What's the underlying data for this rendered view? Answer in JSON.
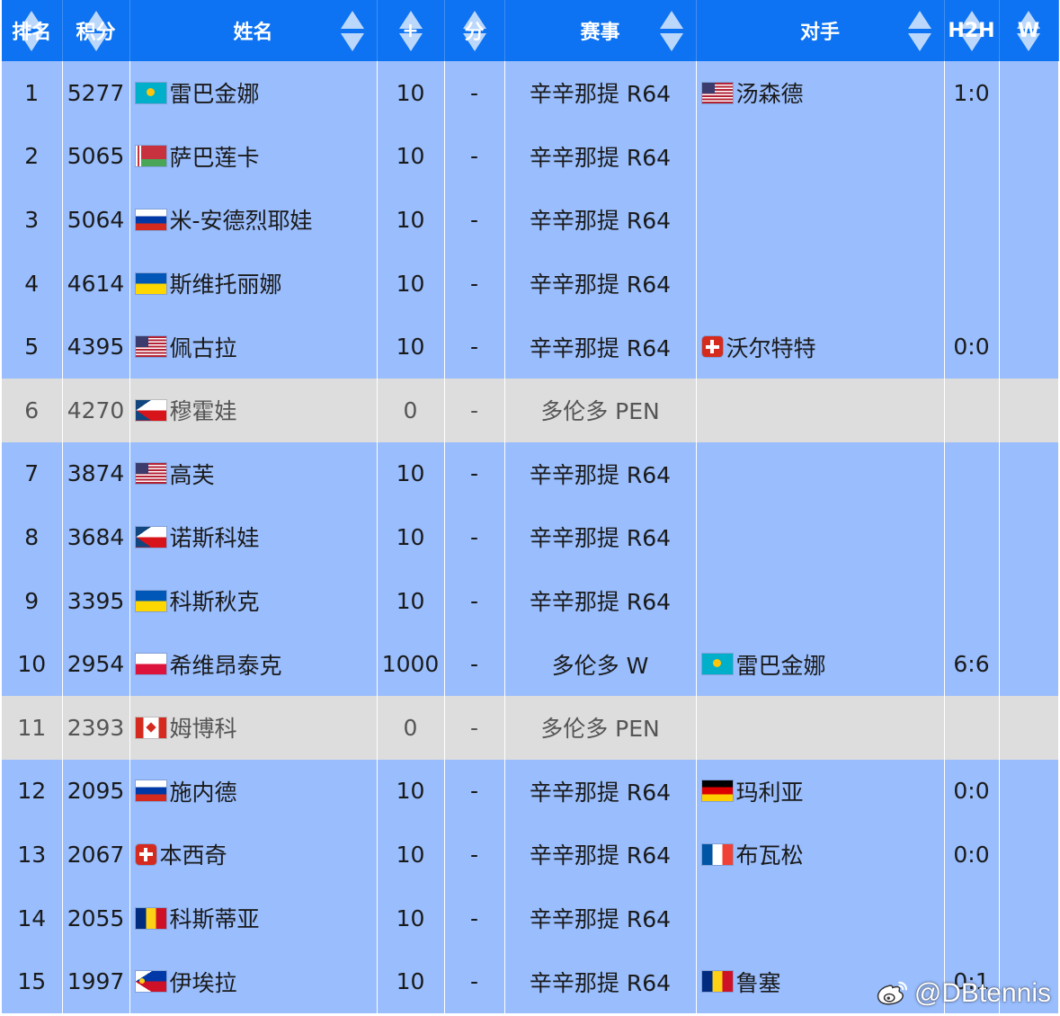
{
  "table": {
    "headers": [
      "排名",
      "积分",
      "姓名",
      "+",
      "分",
      "赛事",
      "对手",
      "H2H",
      "W"
    ],
    "rows": [
      {
        "rank": "1",
        "points": "5277",
        "flag": "kz",
        "name": "雷巴金娜",
        "plus": "10",
        "score": "-",
        "event": "辛辛那提 R64",
        "opp_flag": "us",
        "opponent": "汤森德",
        "h2h": "1:0",
        "w": "",
        "style": "blue"
      },
      {
        "rank": "2",
        "points": "5065",
        "flag": "by",
        "name": "萨巴莲卡",
        "plus": "10",
        "score": "-",
        "event": "辛辛那提 R64",
        "opp_flag": "",
        "opponent": "",
        "h2h": "",
        "w": "",
        "style": "blue"
      },
      {
        "rank": "3",
        "points": "5064",
        "flag": "ru",
        "name": "米-安德烈耶娃",
        "plus": "10",
        "score": "-",
        "event": "辛辛那提 R64",
        "opp_flag": "",
        "opponent": "",
        "h2h": "",
        "w": "",
        "style": "blue"
      },
      {
        "rank": "4",
        "points": "4614",
        "flag": "ua",
        "name": "斯维托丽娜",
        "plus": "10",
        "score": "-",
        "event": "辛辛那提 R64",
        "opp_flag": "",
        "opponent": "",
        "h2h": "",
        "w": "",
        "style": "blue"
      },
      {
        "rank": "5",
        "points": "4395",
        "flag": "us",
        "name": "佩古拉",
        "plus": "10",
        "score": "-",
        "event": "辛辛那提 R64",
        "opp_flag": "ch",
        "opponent": "沃尔特特",
        "h2h": "0:0",
        "w": "",
        "style": "blue"
      },
      {
        "rank": "6",
        "points": "4270",
        "flag": "cz",
        "name": "穆霍娃",
        "plus": "0",
        "score": "-",
        "event": "多伦多 PEN",
        "opp_flag": "",
        "opponent": "",
        "h2h": "",
        "w": "",
        "style": "gray"
      },
      {
        "rank": "7",
        "points": "3874",
        "flag": "us",
        "name": "高芙",
        "plus": "10",
        "score": "-",
        "event": "辛辛那提 R64",
        "opp_flag": "",
        "opponent": "",
        "h2h": "",
        "w": "",
        "style": "blue"
      },
      {
        "rank": "8",
        "points": "3684",
        "flag": "cz",
        "name": "诺斯科娃",
        "plus": "10",
        "score": "-",
        "event": "辛辛那提 R64",
        "opp_flag": "",
        "opponent": "",
        "h2h": "",
        "w": "",
        "style": "blue"
      },
      {
        "rank": "9",
        "points": "3395",
        "flag": "ua",
        "name": "科斯秋克",
        "plus": "10",
        "score": "-",
        "event": "辛辛那提 R64",
        "opp_flag": "",
        "opponent": "",
        "h2h": "",
        "w": "",
        "style": "blue"
      },
      {
        "rank": "10",
        "points": "2954",
        "flag": "pl",
        "name": "希维昂泰克",
        "plus": "1000",
        "score": "-",
        "event": "多伦多 W",
        "opp_flag": "kz",
        "opponent": "雷巴金娜",
        "h2h": "6:6",
        "w": "",
        "style": "blue"
      },
      {
        "rank": "11",
        "points": "2393",
        "flag": "ca",
        "name": "姆博科",
        "plus": "0",
        "score": "-",
        "event": "多伦多 PEN",
        "opp_flag": "",
        "opponent": "",
        "h2h": "",
        "w": "",
        "style": "gray"
      },
      {
        "rank": "12",
        "points": "2095",
        "flag": "ru",
        "name": "施内德",
        "plus": "10",
        "score": "-",
        "event": "辛辛那提 R64",
        "opp_flag": "de",
        "opponent": "玛利亚",
        "h2h": "0:0",
        "w": "",
        "style": "blue"
      },
      {
        "rank": "13",
        "points": "2067",
        "flag": "ch",
        "name": "本西奇",
        "plus": "10",
        "score": "-",
        "event": "辛辛那提 R64",
        "opp_flag": "fr",
        "opponent": "布瓦松",
        "h2h": "0:0",
        "w": "",
        "style": "blue"
      },
      {
        "rank": "14",
        "points": "2055",
        "flag": "ro",
        "name": "科斯蒂亚",
        "plus": "10",
        "score": "-",
        "event": "辛辛那提 R64",
        "opp_flag": "",
        "opponent": "",
        "h2h": "",
        "w": "",
        "style": "blue"
      },
      {
        "rank": "15",
        "points": "1997",
        "flag": "ph",
        "name": "伊埃拉",
        "plus": "10",
        "score": "-",
        "event": "辛辛那提 R64",
        "opp_flag": "ro",
        "opponent": "鲁塞",
        "h2h": "0:1",
        "w": "",
        "style": "blue"
      }
    ]
  },
  "watermark": {
    "text": "@DBtennis",
    "icon": "weibo-icon"
  },
  "colors": {
    "header_bg": "#0d73f2",
    "row_blue": "#99bdfd",
    "row_gray": "#dddddd"
  }
}
